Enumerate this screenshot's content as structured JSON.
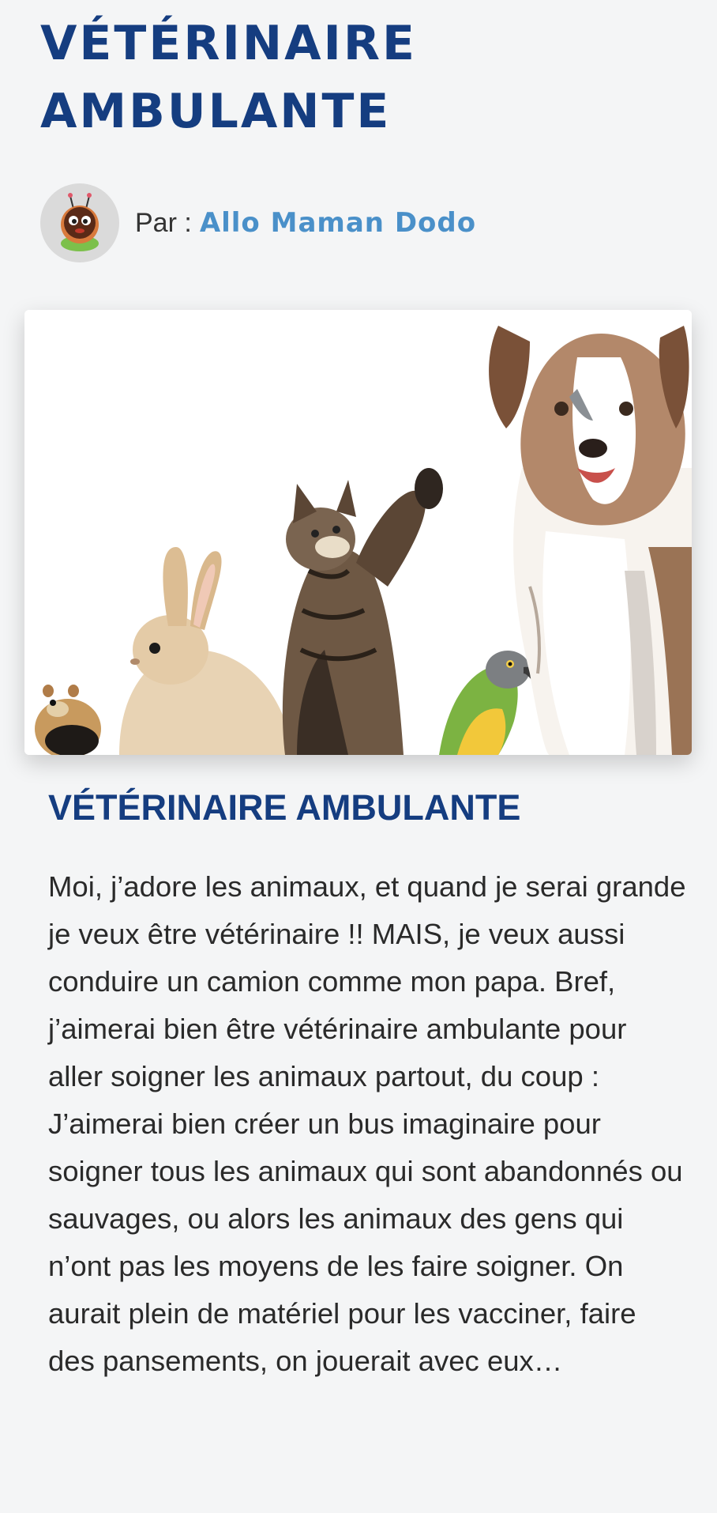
{
  "page": {
    "title_line1": "VÉTÉRINAIRE",
    "title_line2": "AMBULANTE"
  },
  "author": {
    "prefix": "Par :",
    "name": "Allo Maman Dodo",
    "avatar_icon": "ladybug-mascot-icon"
  },
  "hero": {
    "image_description_icon": "animals-group-image"
  },
  "article": {
    "heading": "VÉTÉRINAIRE AMBULANTE",
    "paragraphs": [
      "Moi, j’adore les animaux, et quand je serai grande je veux être vétérinaire !! MAIS, je veux aussi conduire un camion comme mon papa. Bref, j’aimerai bien être vétérinaire ambulante pour aller soigner les animaux partout, du coup :",
      "J’aimerai bien créer un bus imaginaire pour soigner tous les animaux qui sont abandonnés ou sauvages, ou alors les animaux des gens qui n’ont pas les moyens de les faire soigner. On aurait plein de matériel pour les vacciner, faire des pansements, on jouerait avec eux…"
    ]
  },
  "colors": {
    "title": "#153d80",
    "link": "#4a90c9",
    "background": "#f4f5f6"
  }
}
